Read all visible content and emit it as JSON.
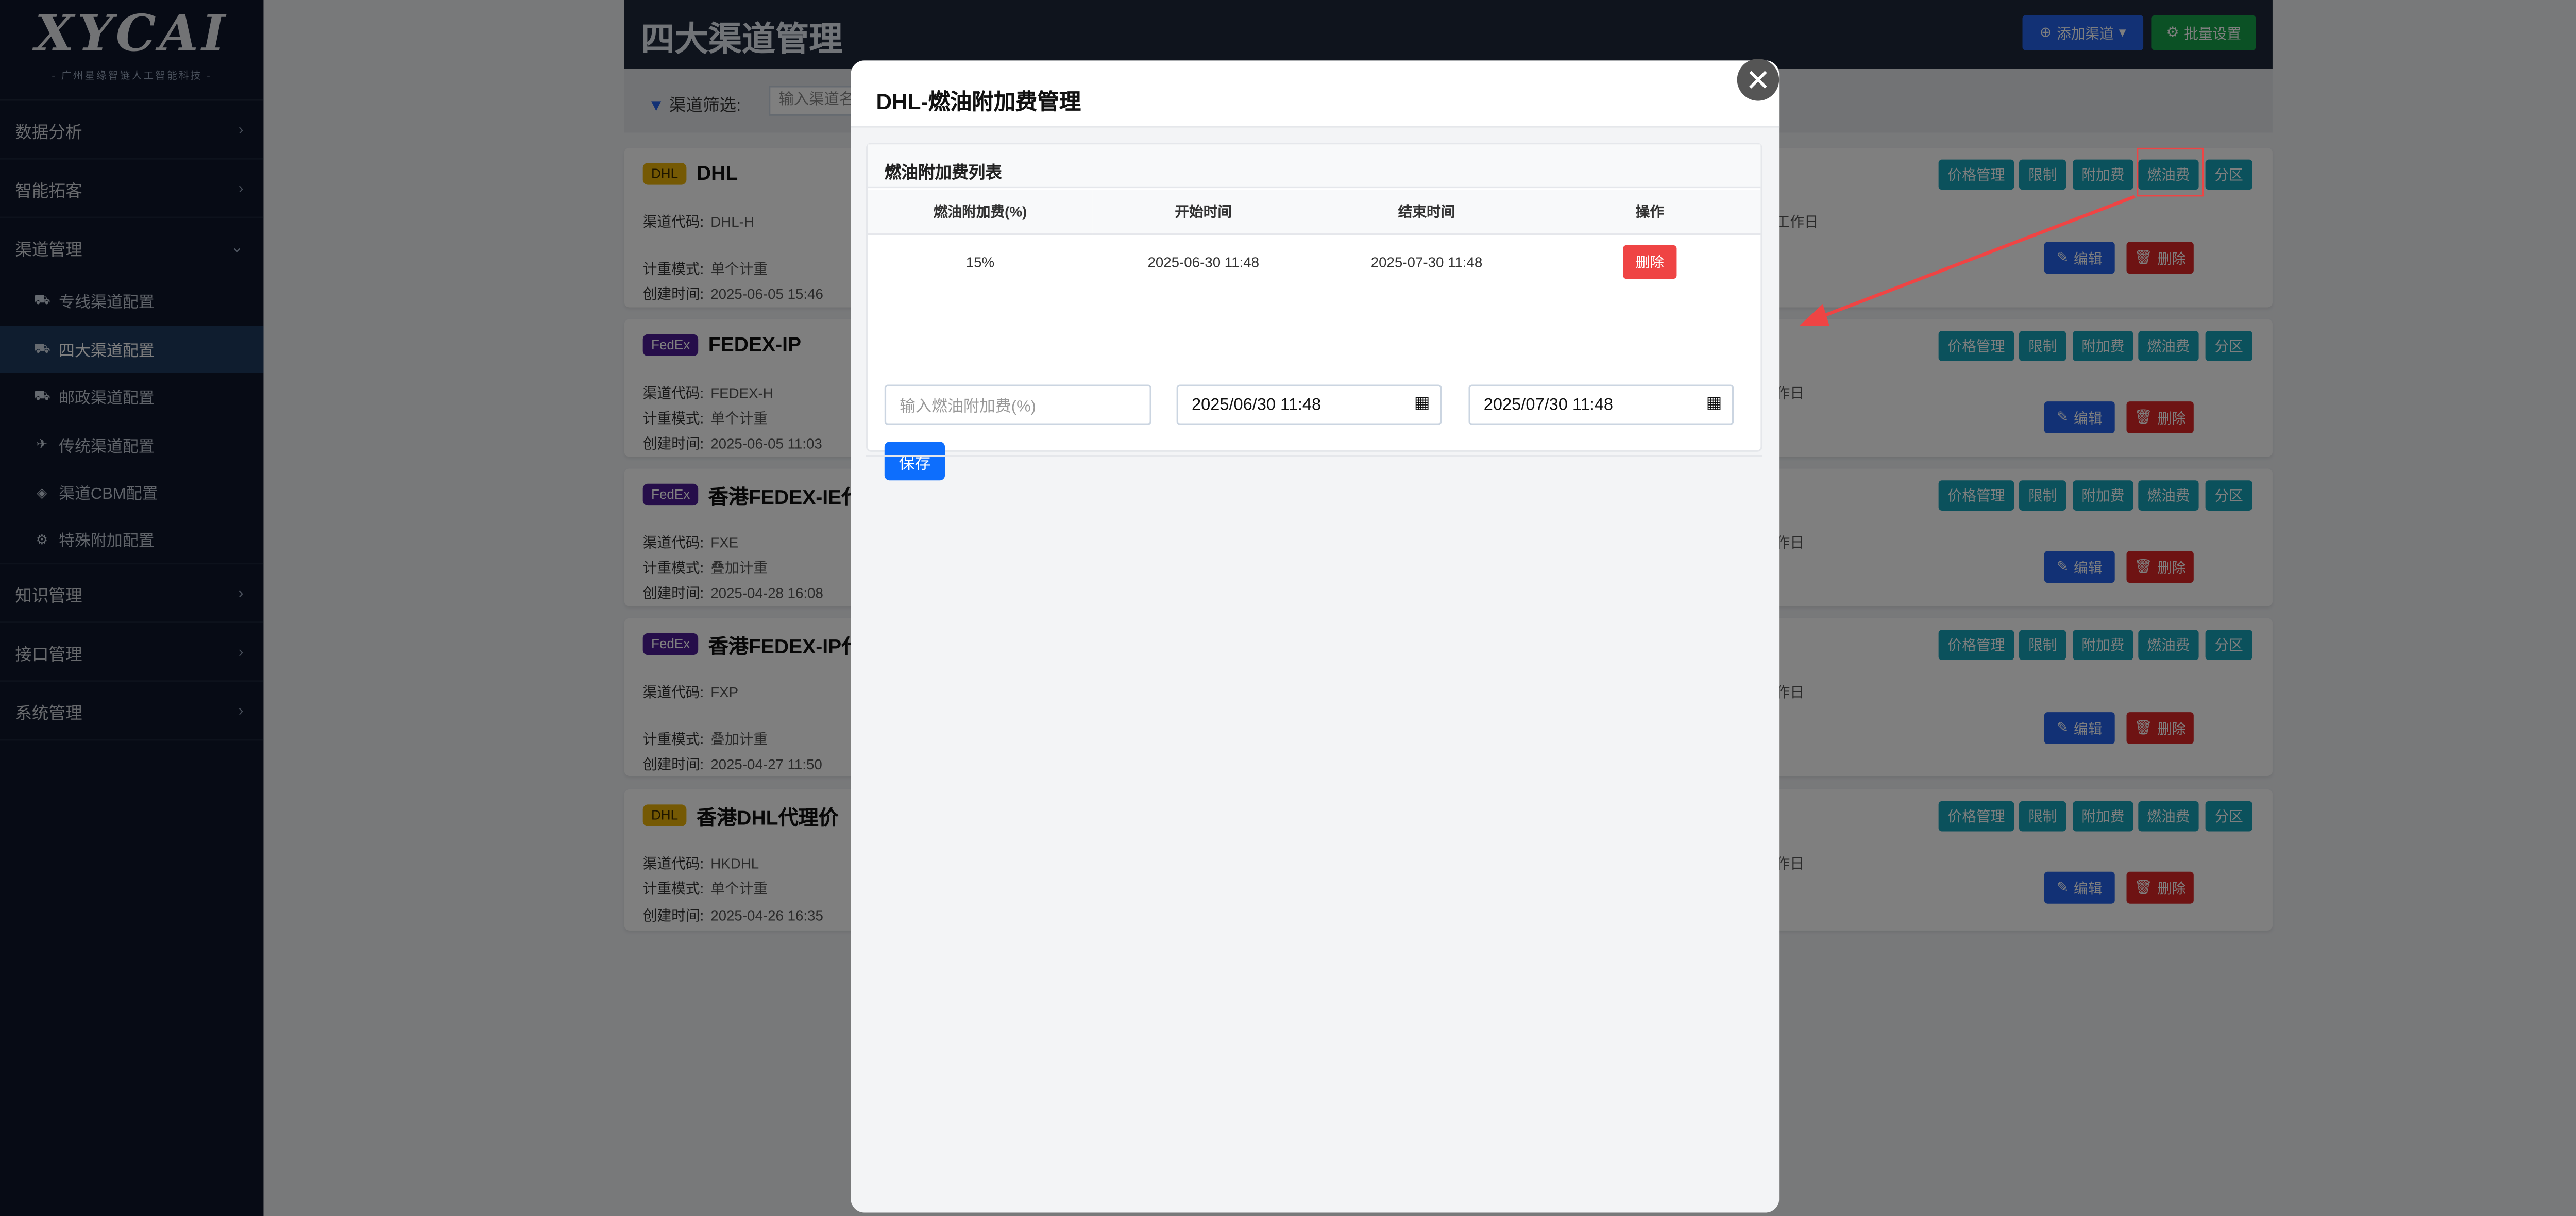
{
  "sidebar": {
    "logo": "XYCAI",
    "logo_sub": "- 广州星缘智链人工智能科技 -",
    "items": [
      {
        "label": "数据分析"
      },
      {
        "label": "智能拓客"
      },
      {
        "label": "渠道管理"
      },
      {
        "label": "知识管理"
      },
      {
        "label": "接口管理"
      },
      {
        "label": "系统管理"
      }
    ],
    "sub_items": [
      {
        "label": "专线渠道配置",
        "icon": "truck-icon"
      },
      {
        "label": "四大渠道配置",
        "icon": "truck-icon"
      },
      {
        "label": "邮政渠道配置",
        "icon": "truck-icon"
      },
      {
        "label": "传统渠道配置",
        "icon": "plane-icon"
      },
      {
        "label": "渠道CBM配置",
        "icon": "cube-icon"
      },
      {
        "label": "特殊附加配置",
        "icon": "gear-icon"
      }
    ]
  },
  "header": {
    "title": "四大渠道管理",
    "add_button": "添加渠道",
    "batch_button": "批量设置"
  },
  "filter": {
    "label": "渠道筛选:",
    "placeholder": "输入渠道名"
  },
  "labels": {
    "code": "渠道代码:",
    "mode": "计重模式:",
    "created": "创建时间:"
  },
  "card_actions": [
    "价格管理",
    "限制",
    "附加费",
    "燃油费",
    "分区"
  ],
  "edit_label": "编辑",
  "delete_label": "删除",
  "channels": [
    {
      "badge": "DHL",
      "name": "DHL",
      "code": "DHL-H",
      "mode": "单个计重",
      "created": "2025-06-05 15:46",
      "extra": "工作日"
    },
    {
      "badge": "FedEx",
      "name": "FEDEX-IP",
      "code": "FEDEX-H",
      "mode": "单个计重",
      "created": "2025-06-05 11:03",
      "extra": "作日"
    },
    {
      "badge": "FedEx",
      "name": "香港FEDEX-IE代",
      "code": "FXE",
      "mode": "叠加计重",
      "created": "2025-04-28 16:08",
      "extra": "作日"
    },
    {
      "badge": "FedEx",
      "name": "香港FEDEX-IP代",
      "code": "FXP",
      "mode": "叠加计重",
      "created": "2025-04-27 11:50",
      "extra": "作日"
    },
    {
      "badge": "DHL",
      "name": "香港DHL代理价",
      "code": "HKDHL",
      "mode": "单个计重",
      "created": "2025-04-26 16:35",
      "extra": "作日"
    }
  ],
  "modal": {
    "title": "DHL-燃油附加费管理",
    "section_title": "燃油附加费列表",
    "columns": [
      "燃油附加费(%)",
      "开始时间",
      "结束时间",
      "操作"
    ],
    "rows": [
      {
        "rate": "15%",
        "start": "2025-06-30 11:48",
        "end": "2025-07-30 11:48",
        "action": "删除"
      }
    ],
    "rate_placeholder": "输入燃油附加费(%)",
    "start_value": "2025/06/30 11:48",
    "end_value": "2025/07/30 11:48",
    "save_label": "保存",
    "close_glyph": "✕"
  },
  "colors": {
    "sidebar_bg": "#0f172a",
    "accent_blue": "#2563eb",
    "action_teal": "#17a2b8",
    "danger_red": "#dc2626",
    "success_green": "#16a34a",
    "annotation_red": "#ef4444"
  }
}
